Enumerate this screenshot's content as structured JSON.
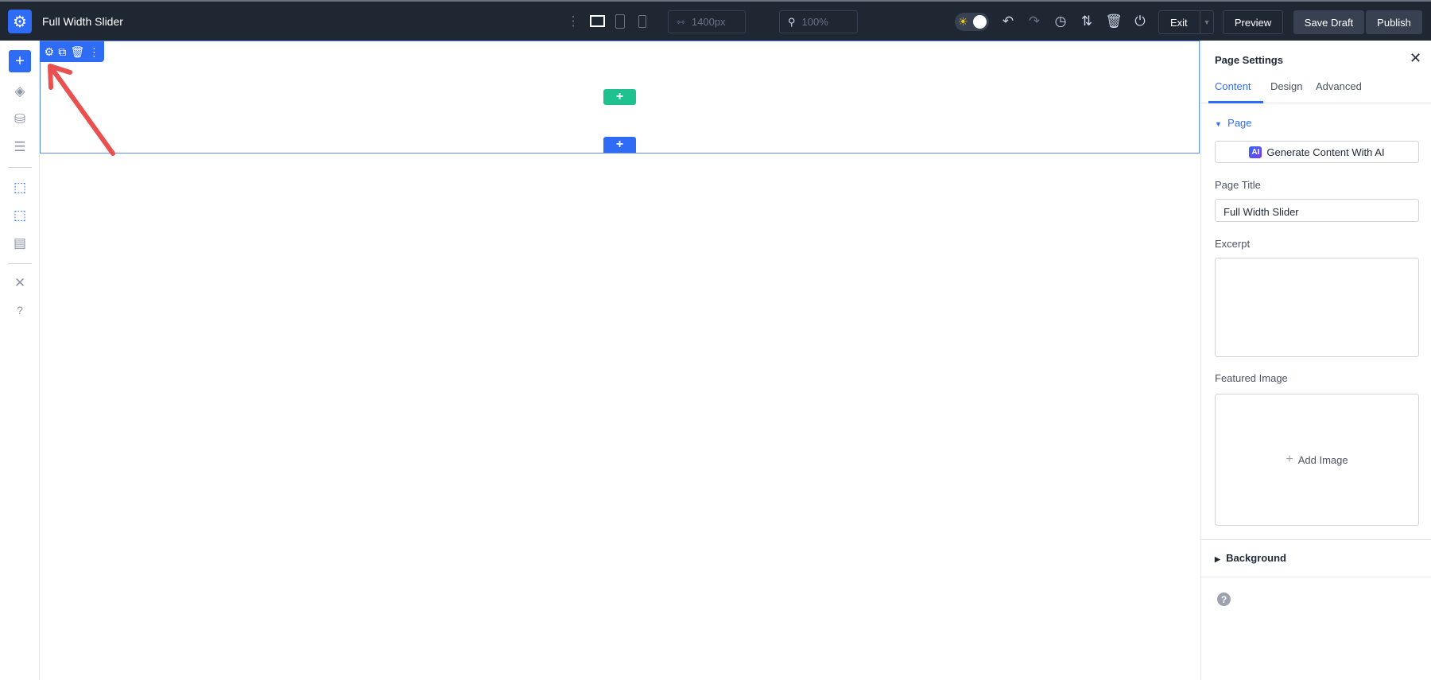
{
  "header": {
    "title": "Full Width Slider",
    "width_value": "1400px",
    "zoom_value": "100%",
    "exit_label": "Exit",
    "preview_label": "Preview",
    "save_draft_label": "Save Draft",
    "publish_label": "Publish"
  },
  "panel": {
    "title": "Page Settings",
    "tabs": [
      "Content",
      "Design",
      "Advanced"
    ],
    "active_tab": "Content",
    "section_page": "Page",
    "ai_button": "Generate Content With AI",
    "ai_badge": "AI",
    "page_title_label": "Page Title",
    "page_title_value": "Full Width Slider",
    "excerpt_label": "Excerpt",
    "excerpt_value": "",
    "featured_image_label": "Featured Image",
    "add_image_label": "Add Image",
    "section_background": "Background"
  },
  "colors": {
    "accent": "#2f6cf5",
    "header_bg": "#1f2733",
    "green": "#1fc18f",
    "annotation": "#e8514f"
  }
}
